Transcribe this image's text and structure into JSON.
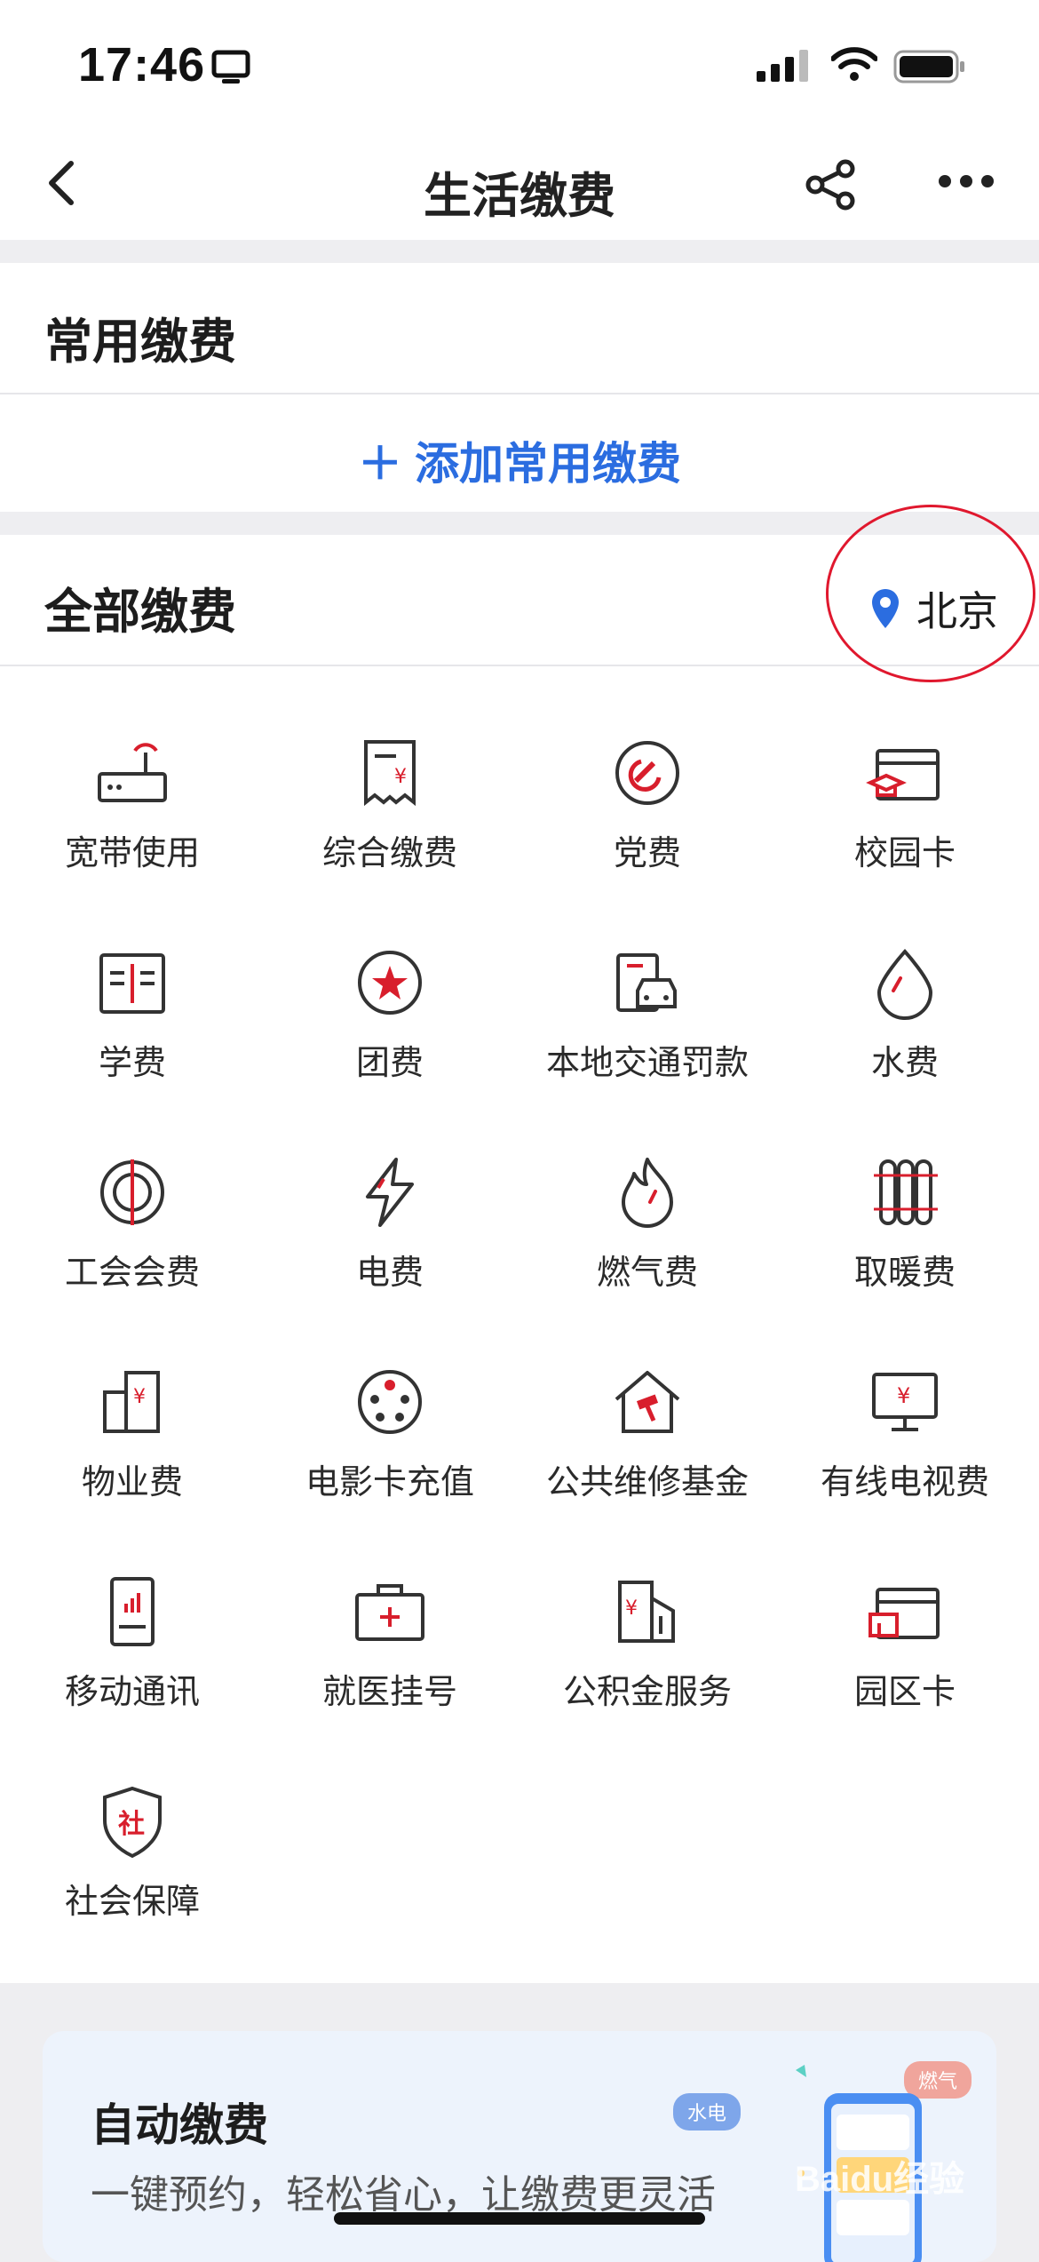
{
  "status": {
    "time": "17:46"
  },
  "nav": {
    "title": "生活缴费"
  },
  "common": {
    "title": "常用缴费",
    "add_label": "＋ 添加常用缴费"
  },
  "all": {
    "title": "全部缴费",
    "location": "北京"
  },
  "items": [
    {
      "label": "宽带使用",
      "icon": "router-icon"
    },
    {
      "label": "综合缴费",
      "icon": "receipt-icon"
    },
    {
      "label": "党费",
      "icon": "party-emblem-icon"
    },
    {
      "label": "校园卡",
      "icon": "campus-card-icon"
    },
    {
      "label": "学费",
      "icon": "book-icon"
    },
    {
      "label": "团费",
      "icon": "star-badge-icon"
    },
    {
      "label": "本地交通罚款",
      "icon": "car-ticket-icon"
    },
    {
      "label": "水费",
      "icon": "water-drop-icon"
    },
    {
      "label": "工会会费",
      "icon": "union-icon"
    },
    {
      "label": "电费",
      "icon": "lightning-icon"
    },
    {
      "label": "燃气费",
      "icon": "flame-icon"
    },
    {
      "label": "取暖费",
      "icon": "radiator-icon"
    },
    {
      "label": "物业费",
      "icon": "building-icon"
    },
    {
      "label": "电影卡充值",
      "icon": "film-reel-icon"
    },
    {
      "label": "公共维修基金",
      "icon": "house-hammer-icon"
    },
    {
      "label": "有线电视费",
      "icon": "tv-icon"
    },
    {
      "label": "移动通讯",
      "icon": "phone-signal-icon"
    },
    {
      "label": "就医挂号",
      "icon": "medical-kit-icon"
    },
    {
      "label": "公积金服务",
      "icon": "fund-building-icon"
    },
    {
      "label": "园区卡",
      "icon": "park-card-icon"
    },
    {
      "label": "社会保障",
      "icon": "shield-icon"
    }
  ],
  "auto": {
    "title": "自动缴费",
    "subtitle": "一键预约，轻松省心，让缴费更灵活",
    "tag_water": "水电",
    "tag_gas": "燃气"
  },
  "watermark": "Baidu经验",
  "colors": {
    "accent": "#2b6de0",
    "red": "#d81e2c"
  }
}
